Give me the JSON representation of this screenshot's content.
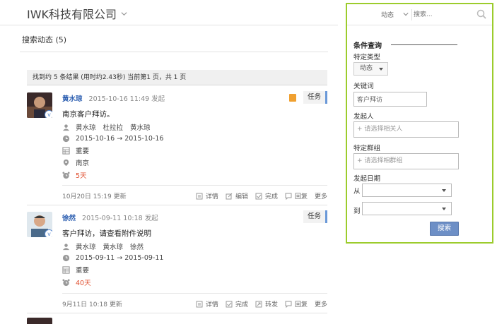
{
  "header": {
    "company": "IWK科技有限公司"
  },
  "page_title": "搜索动态 (5)",
  "result_summary": "找到约 5 条结果  (用时约2.43秒)  当前第1 页，共 1 页",
  "items": [
    {
      "author": "黄水琼",
      "datetime": "2015-10-16 11:49 发起",
      "type": "任务",
      "subject": "南京客户拜访。",
      "people": [
        "黄水琼",
        "杜拉拉",
        "黄水琼"
      ],
      "date_range": "2015-10-16 → 2015-10-16",
      "priority": "重要",
      "location": "南京",
      "days": "5天",
      "updated": "10月20日 15:19 更新",
      "actions": [
        "详情",
        "编辑",
        "完成",
        "回复",
        "更多"
      ]
    },
    {
      "author": "徐然",
      "datetime": "2015-09-11 10:18 发起",
      "type": "任务",
      "subject": "客户拜访，请查看附件说明",
      "people": [
        "黄水琼",
        "黄水琼",
        "徐然"
      ],
      "date_range": "2015-09-11 → 2015-09-11",
      "priority": "重要",
      "days": "40天",
      "updated": "9月11日 10:18 更新",
      "actions": [
        "详情",
        "完成",
        "转发",
        "回复",
        "更多"
      ]
    }
  ],
  "panel": {
    "search_type": "动态",
    "search_placeholder": "搜索...",
    "section_title": "条件查询",
    "type_label": "特定类型",
    "type_value": "动态",
    "keyword_label": "关键词",
    "keyword_value": "客户拜访",
    "initiator_label": "发起人",
    "initiator_placeholder": "+ 请选择相关人",
    "group_label": "特定群组",
    "group_placeholder": "+ 请选择相群组",
    "date_label": "发起日期",
    "from_label": "从",
    "to_label": "到",
    "search_button": "搜索"
  },
  "colors": {
    "panel_border": "#9ccc2c",
    "accent": "#6a98d8",
    "link": "#2a5db0",
    "warning": "#e05030",
    "button": "#6d8fc6"
  }
}
